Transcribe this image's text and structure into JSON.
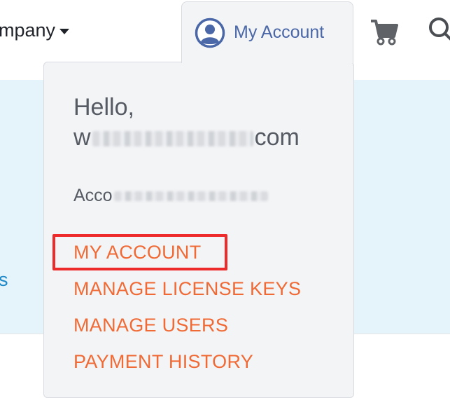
{
  "header": {
    "company_menu_label": "mpany",
    "account_label": "My Account"
  },
  "banner": {
    "link_text": "s"
  },
  "dropdown": {
    "greeting": "Hello,",
    "email_prefix": "w",
    "email_suffix": "com",
    "account_number_prefix": "Acco",
    "items": [
      {
        "label": "MY ACCOUNT"
      },
      {
        "label": "MANAGE LICENSE KEYS"
      },
      {
        "label": "MANAGE USERS"
      },
      {
        "label": "PAYMENT HISTORY"
      }
    ]
  },
  "colors": {
    "menu_item": "#f06a35",
    "account_label": "#4a67a8",
    "highlight": "#ee2b2b",
    "banner_bg": "#e5f4fb"
  },
  "icons": [
    "user-circle-icon",
    "cart-icon",
    "search-icon",
    "caret-down-icon"
  ]
}
